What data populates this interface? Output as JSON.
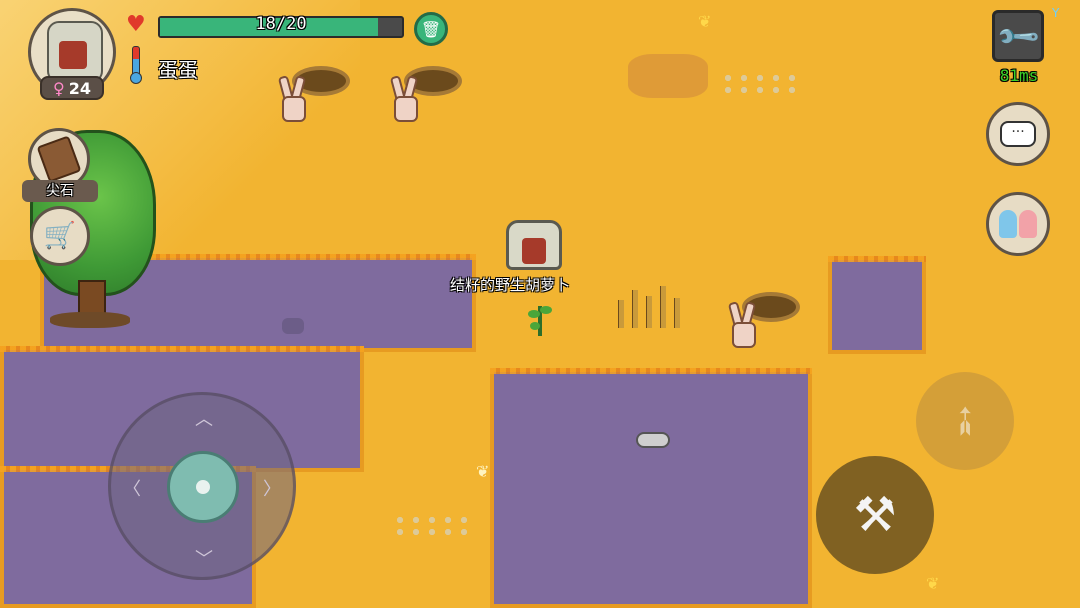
{
  "player": {
    "level": "24",
    "hp_text": "18/20",
    "hp": {
      "current": 18,
      "max": 20
    },
    "name": "蛋蛋"
  },
  "inventory_item": {
    "label": "尖石"
  },
  "ping": {
    "text": "81ms"
  },
  "world": {
    "plant_label": "结籽的野生胡萝卜"
  },
  "colors": {
    "hp_bar": "#39b57a",
    "ground_orange": "#f2b431",
    "ground_purple": "#7f6b9e",
    "ping_green": "#3bd12a"
  },
  "icons": {
    "heart": "heart-icon",
    "thermometer": "thermometer-icon",
    "trash": "trash-icon",
    "settings": "wrench-icon",
    "chat": "chat-icon",
    "friends": "friends-icon",
    "shop": "shopping-cart-icon",
    "bow": "bow-icon",
    "attack": "tool-attack-icon",
    "female": "female-icon"
  }
}
